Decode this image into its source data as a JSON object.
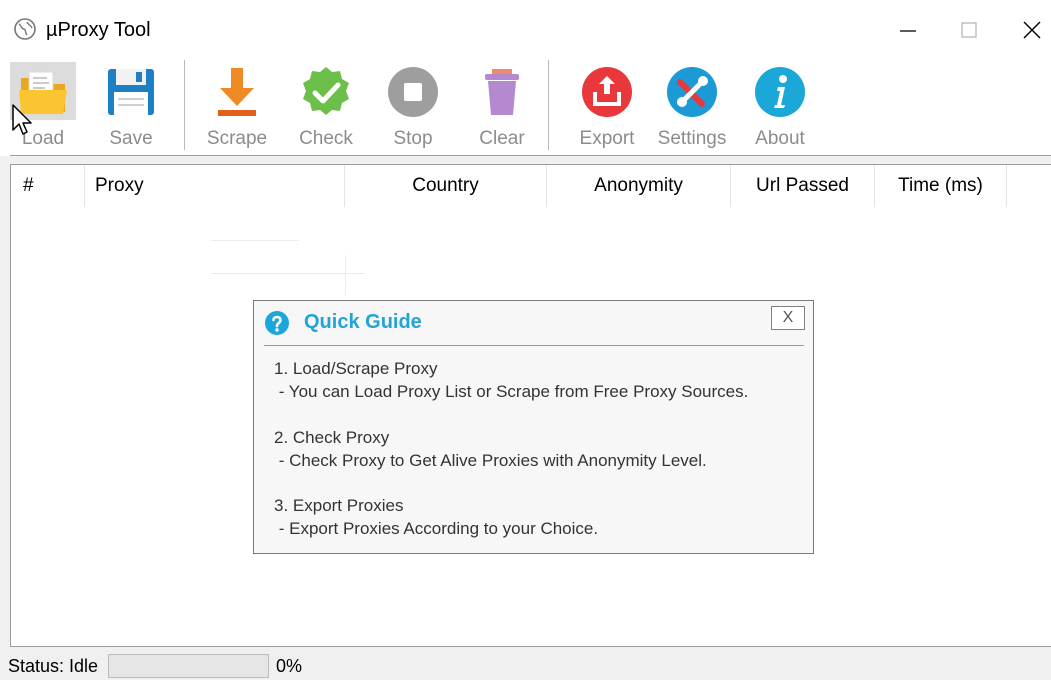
{
  "window": {
    "title": "µProxy Tool",
    "minimize": "—",
    "maximize": "□",
    "close": "✕"
  },
  "toolbar": {
    "buttons": [
      {
        "label": "Load",
        "icon": "folder-icon"
      },
      {
        "label": "Save",
        "icon": "floppy-disk-icon"
      },
      {
        "label": "Scrape",
        "icon": "download-arrow-icon"
      },
      {
        "label": "Check",
        "icon": "checkmark-badge-icon"
      },
      {
        "label": "Stop",
        "icon": "stop-icon"
      },
      {
        "label": "Clear",
        "icon": "trash-can-icon"
      },
      {
        "label": "Export",
        "icon": "export-icon"
      },
      {
        "label": "Settings",
        "icon": "tools-icon"
      },
      {
        "label": "About",
        "icon": "info-icon"
      }
    ]
  },
  "table": {
    "columns": [
      "#",
      "Proxy",
      "Country",
      "Anonymity",
      "Url Passed",
      "Time (ms)"
    ],
    "rows": []
  },
  "guide": {
    "title": "Quick Guide",
    "close_label": "X",
    "lines": [
      "1. Load/Scrape Proxy",
      " - You can Load Proxy List or Scrape from Free Proxy Sources.",
      "2. Check Proxy",
      " - Check Proxy to Get Alive Proxies with Anonymity Level.",
      "3. Export Proxies",
      " - Export Proxies According to your Choice."
    ]
  },
  "status": {
    "label": "Status: Idle",
    "progress_percent": 0,
    "progress_text": "0%"
  },
  "colors": {
    "accent": "#22a5d6",
    "check_green": "#6cc04a",
    "export_red": "#e8383b",
    "scrape_orange": "#f08a24",
    "clear_purple": "#b489cf"
  }
}
